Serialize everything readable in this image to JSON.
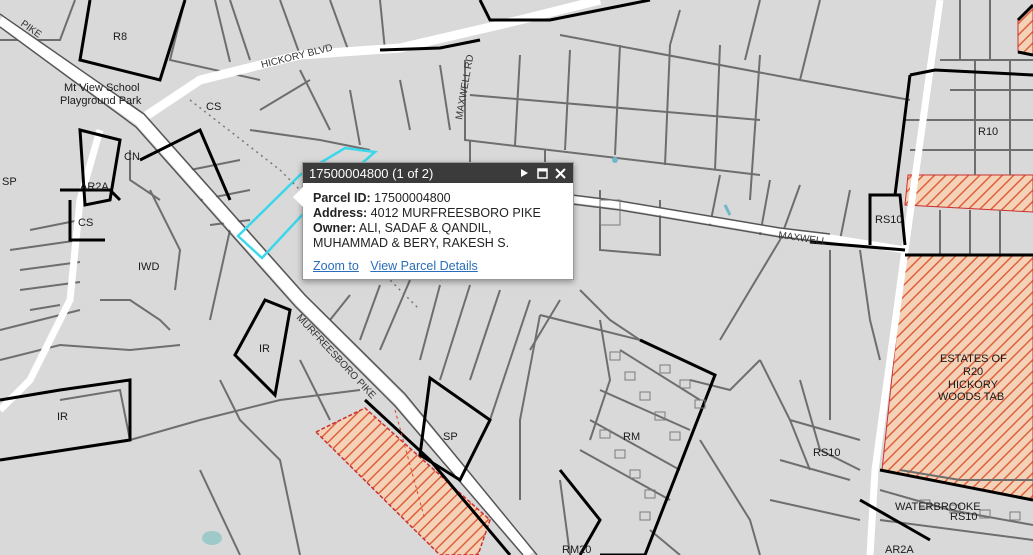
{
  "map": {
    "zones": {
      "r8": "R8",
      "cs1": "CS",
      "cn": "CN",
      "sp_left": "SP",
      "ar2a": "AR2A",
      "cs2": "CS",
      "iwd": "IWD",
      "ir1": "IR",
      "ir2": "IR",
      "sp2": "SP",
      "rm20": "RM20",
      "rm_mid": "RM",
      "rs10_a": "RS10",
      "rs10_b": "RS10",
      "rs10_c": "RS10",
      "r10": "R10",
      "r20": "R20",
      "ar2a_b": "AR2A"
    },
    "place_labels": {
      "school_line1": "Mt View School",
      "school_line2": "Playground Park",
      "subdivision_line1": "ESTATES OF",
      "subdivision_line2": "HICKORY",
      "subdivision_line3": "WOODS TAB",
      "waterbrooke": "WATERBROOKE"
    },
    "roads": {
      "hickory": "HICKORY BLVD",
      "murfreesboro": "MURFREESBORO PIKE",
      "pike_top": "PIKE",
      "maxwell": "MAXWELL RD",
      "maxwell_east": "MAXWELL"
    },
    "colors": {
      "background": "#d9d9d9",
      "parcel_line": "#6e6e6e",
      "zone_line": "#000000",
      "selection": "#33d6e6",
      "hatch_orange": "#f0a070",
      "hatch_red": "#d9472b"
    }
  },
  "popup": {
    "title": "17500004800 (1 of 2)",
    "parcel_id_label": "Parcel ID:",
    "parcel_id": "17500004800",
    "address_label": "Address:",
    "address": "4012 MURFREESBORO PIKE",
    "owner_label": "Owner:",
    "owner_line1": "ALI, SADAF & QANDIL,",
    "owner_line2": "MUHAMMAD & BERY, RAKESH S.",
    "zoom_link": "Zoom to",
    "details_link": "View Parcel Details",
    "icons": {
      "next": "next-arrow-icon",
      "maximize": "maximize-icon",
      "close": "close-icon"
    }
  }
}
